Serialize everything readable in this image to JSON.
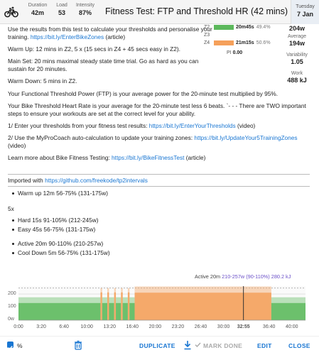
{
  "header": {
    "duration": {
      "label": "Duration",
      "value": "42m"
    },
    "load": {
      "label": "Load",
      "value": "53"
    },
    "intensity": {
      "label": "Intensity",
      "value": "87%"
    },
    "title": "Fitness Test: FTP and Threshold HR (42 mins)",
    "day": "Tuesday",
    "date": "7 Jan"
  },
  "description": {
    "p1_text": "Use the results from this test to calculate your thresholds and personalise your training. ",
    "p1_link": "https://bit.ly/EnterBikeZones",
    "p1_tail": " (article)",
    "p2": "Warm Up: 12 mins in Z2, 5 x (15 secs in Z4 + 45 secs easy in Z2).",
    "p3": "Main Set: 20 mins maximal steady state time trial. Go as hard as you can sustain for 20 minutes.",
    "p4": "Warm Down: 5 mins in Z2.",
    "p5": "Your Functional Threshold Power (FTP) is your average power for the 20-minute test multiplied by 95%.",
    "p6": "Your Bike Threshold Heart Rate is your average for the 20-minute test less 6 beats. `- - - There are TWO important steps to ensure your workouts are set at the correct level for your ability.",
    "p7_text": "1/ Enter your thresholds from your fitness test results: ",
    "p7_link": "https://bit.ly/EnterYourThresholds",
    "p7_tail": " (video)",
    "p8_text": "2/ Use the MyProCoach auto-calculation to update your training zones: ",
    "p8_link": "https://bit.ly/UpdateYour5TrainingZones",
    "p8_tail": " (video)",
    "p9_text": "Learn more about Bike Fitness Testing: ",
    "p9_link": "https://bit.ly/BikeFitnessTest",
    "p9_tail": " (article)",
    "p10_text": "Imported with ",
    "p10_link": "https://github.com/freekode/tp2intervals",
    "p10_tail": ""
  },
  "zones": [
    {
      "label": "Z2",
      "time": "20m45s",
      "pct": "49.4%",
      "color": "#5cb85c",
      "fraction": 0.494
    },
    {
      "label": "Z3",
      "time": "",
      "pct": "",
      "color": "#f0c040",
      "fraction": 0
    },
    {
      "label": "Z4",
      "time": "21m15s",
      "pct": "50.6%",
      "color": "#f5a05a",
      "fraction": 0.506
    }
  ],
  "pi": {
    "label": "PI",
    "value": "0.00"
  },
  "right_stats": [
    {
      "label": "",
      "value": "204w"
    },
    {
      "label": "Average",
      "value": "194w"
    },
    {
      "label": "Variability",
      "value": "1.05"
    },
    {
      "label": "Work",
      "value": "488 kJ"
    }
  ],
  "steps": {
    "warmup": "Warm up 12m 56-75% (131-175w)",
    "repeat": "5x",
    "hard": "Hard 15s 91-105% (212-245w)",
    "easy": "Easy 45s 56-75% (131-175w)",
    "active": "Active 20m 90-110% (210-257w)",
    "cooldown": "Cool Down 5m 56-75% (131-175w)"
  },
  "chart": {
    "hover_name": "Active 20m",
    "hover_detail": "210-257w (90-110%) 280.2 kJ",
    "y_ticks": [
      "200",
      "100",
      "0w"
    ],
    "x_ticks": [
      "0:00",
      "3:20",
      "6:40",
      "10:00",
      "13:20",
      "16:40",
      "20:00",
      "23:20",
      "26:40",
      "30:00",
      "32:55",
      "36:40",
      "40:00"
    ],
    "cursor_label": "32:55",
    "zone2_color": "#6cc06c",
    "zone4_color": "#f5a96a"
  },
  "chart_data": {
    "type": "area",
    "xlabel": "",
    "ylabel": "",
    "xlim_minutes": [
      0,
      42
    ],
    "ylim": [
      0,
      260
    ],
    "segments": [
      {
        "name": "Warm up",
        "start_min": 0,
        "end_min": 12,
        "low_w": 131,
        "high_w": 175,
        "zone": "Z2"
      },
      {
        "name": "Hard",
        "start_min": 12,
        "end_min": 12.25,
        "low_w": 212,
        "high_w": 245,
        "zone": "Z4"
      },
      {
        "name": "Easy",
        "start_min": 12.25,
        "end_min": 13,
        "low_w": 131,
        "high_w": 175,
        "zone": "Z2"
      },
      {
        "name": "Hard",
        "start_min": 13,
        "end_min": 13.25,
        "low_w": 212,
        "high_w": 245,
        "zone": "Z4"
      },
      {
        "name": "Easy",
        "start_min": 13.25,
        "end_min": 14,
        "low_w": 131,
        "high_w": 175,
        "zone": "Z2"
      },
      {
        "name": "Hard",
        "start_min": 14,
        "end_min": 14.25,
        "low_w": 212,
        "high_w": 245,
        "zone": "Z4"
      },
      {
        "name": "Easy",
        "start_min": 14.25,
        "end_min": 15,
        "low_w": 131,
        "high_w": 175,
        "zone": "Z2"
      },
      {
        "name": "Hard",
        "start_min": 15,
        "end_min": 15.25,
        "low_w": 212,
        "high_w": 245,
        "zone": "Z4"
      },
      {
        "name": "Easy",
        "start_min": 15.25,
        "end_min": 16,
        "low_w": 131,
        "high_w": 175,
        "zone": "Z2"
      },
      {
        "name": "Hard",
        "start_min": 16,
        "end_min": 16.25,
        "low_w": 212,
        "high_w": 245,
        "zone": "Z4"
      },
      {
        "name": "Easy",
        "start_min": 16.25,
        "end_min": 17,
        "low_w": 131,
        "high_w": 175,
        "zone": "Z2"
      },
      {
        "name": "Active",
        "start_min": 17,
        "end_min": 37,
        "low_w": 210,
        "high_w": 257,
        "zone": "Z4"
      },
      {
        "name": "Cool Down",
        "start_min": 37,
        "end_min": 42,
        "low_w": 131,
        "high_w": 175,
        "zone": "Z2"
      }
    ],
    "cursor_min": 32.92
  },
  "toolbar": {
    "percent_label": "%",
    "duplicate": "DUPLICATE",
    "mark_done": "MARK DONE",
    "edit": "EDIT",
    "close": "CLOSE"
  }
}
